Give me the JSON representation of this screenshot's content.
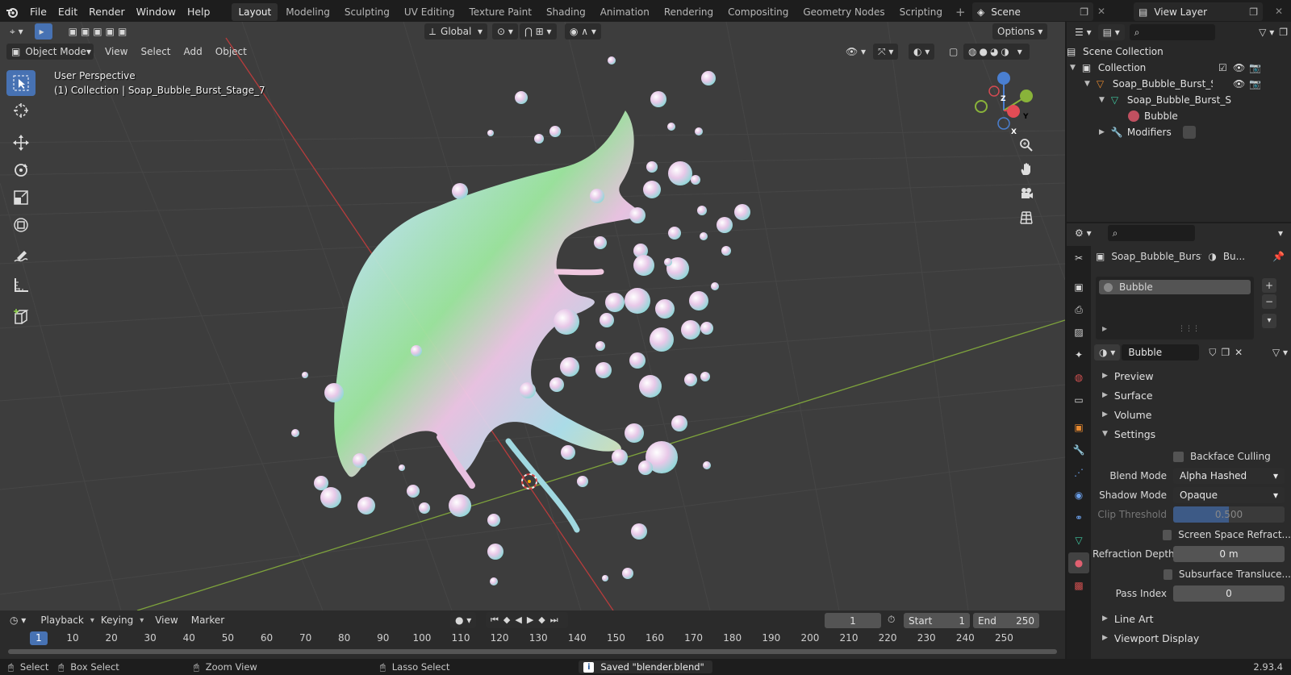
{
  "menu": [
    "File",
    "Edit",
    "Render",
    "Window",
    "Help"
  ],
  "workspaces": [
    "Layout",
    "Modeling",
    "Sculpting",
    "UV Editing",
    "Texture Paint",
    "Shading",
    "Animation",
    "Rendering",
    "Compositing",
    "Geometry Nodes",
    "Scripting"
  ],
  "active_workspace": "Layout",
  "scene": "Scene",
  "view_layer": "View Layer",
  "viewport": {
    "mode": "Object Mode",
    "menus": [
      "View",
      "Select",
      "Add",
      "Object"
    ],
    "transform_orientation": "Global",
    "options": "Options",
    "info_line1": "User Perspective",
    "info_line2": "(1) Collection | Soap_Bubble_Burst_Stage_7",
    "gizmo": {
      "x": "X",
      "y": "Y",
      "z": "Z"
    }
  },
  "timeline": {
    "menus": [
      "Playback",
      "Keying",
      "View",
      "Marker"
    ],
    "current_frame": "1",
    "start_label": "Start",
    "start": "1",
    "end_label": "End",
    "end": "250",
    "ruler": [
      "1",
      "10",
      "20",
      "30",
      "40",
      "50",
      "60",
      "70",
      "80",
      "90",
      "100",
      "110",
      "120",
      "130",
      "140",
      "150",
      "160",
      "170",
      "180",
      "190",
      "200",
      "210",
      "220",
      "230",
      "240",
      "250"
    ]
  },
  "statusbar": {
    "select": "Select",
    "box_select": "Box Select",
    "zoom_view": "Zoom View",
    "lasso_select": "Lasso Select",
    "message": "Saved \"blender.blend\"",
    "version": "2.93.4"
  },
  "outliner": {
    "scene_collection": "Scene Collection",
    "collection": "Collection",
    "object": "Soap_Bubble_Burst_Stage",
    "mesh": "Soap_Bubble_Burst_S",
    "material": "Bubble",
    "modifiers": "Modifiers"
  },
  "properties": {
    "breadcrumb_object": "Soap_Bubble_Burst...",
    "breadcrumb_material": "Bu...",
    "slot": "Bubble",
    "material_name": "Bubble",
    "sections": {
      "preview": "Preview",
      "surface": "Surface",
      "volume": "Volume",
      "settings": "Settings",
      "line_art": "Line Art",
      "viewport_display": "Viewport Display"
    },
    "backface_culling": "Backface Culling",
    "blend_mode_label": "Blend Mode",
    "blend_mode": "Alpha Hashed",
    "shadow_mode_label": "Shadow Mode",
    "shadow_mode": "Opaque",
    "clip_threshold_label": "Clip Threshold",
    "clip_threshold": "0.500",
    "screen_space_refraction": "Screen Space Refract...",
    "refraction_depth_label": "Refraction Depth",
    "refraction_depth": "0 m",
    "subsurface_translucency": "Subsurface Transluce...",
    "pass_index_label": "Pass Index",
    "pass_index": "0"
  }
}
